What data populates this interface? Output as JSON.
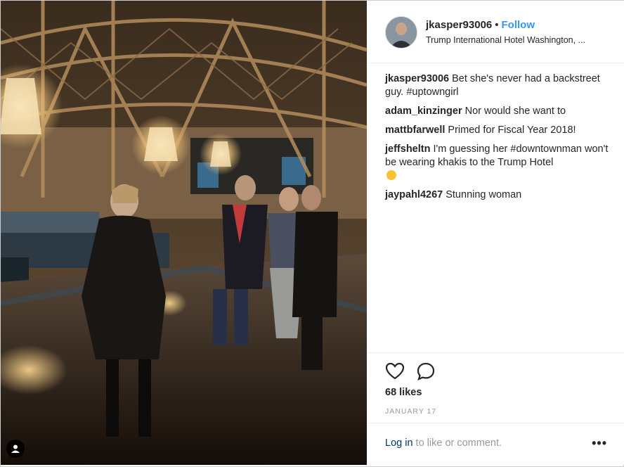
{
  "post": {
    "username": "jkasper93006",
    "separator": "•",
    "follow_label": "Follow",
    "location": "Trump International Hotel Washington, ..."
  },
  "comments": [
    {
      "user": "jkasper93006",
      "text": "Bet she's never had a backstreet guy. #uptowngirl"
    },
    {
      "user": "adam_kinzinger",
      "text": "Nor would she want to"
    },
    {
      "user": "mattbfarwell",
      "text": "Primed for Fiscal Year 2018!"
    },
    {
      "user": "jeffsheltn",
      "text": "I'm guessing her #downtownman won't be wearing khakis to the Trump Hotel"
    },
    {
      "user": "jaypahl4267",
      "text": "Stunning woman"
    }
  ],
  "actions": {
    "likes": "68 likes",
    "date": "JANUARY 17"
  },
  "footer": {
    "login_link": "Log in",
    "login_rest": " to like or comment.",
    "more": "•••"
  },
  "icons": {
    "tag": "person-tag-icon",
    "like": "heart-icon",
    "comment": "comment-bubble-icon",
    "more": "more-options-icon"
  },
  "colors": {
    "accent": "#3897f0",
    "link_dark": "#003569",
    "muted": "#999999",
    "text": "#262626"
  }
}
